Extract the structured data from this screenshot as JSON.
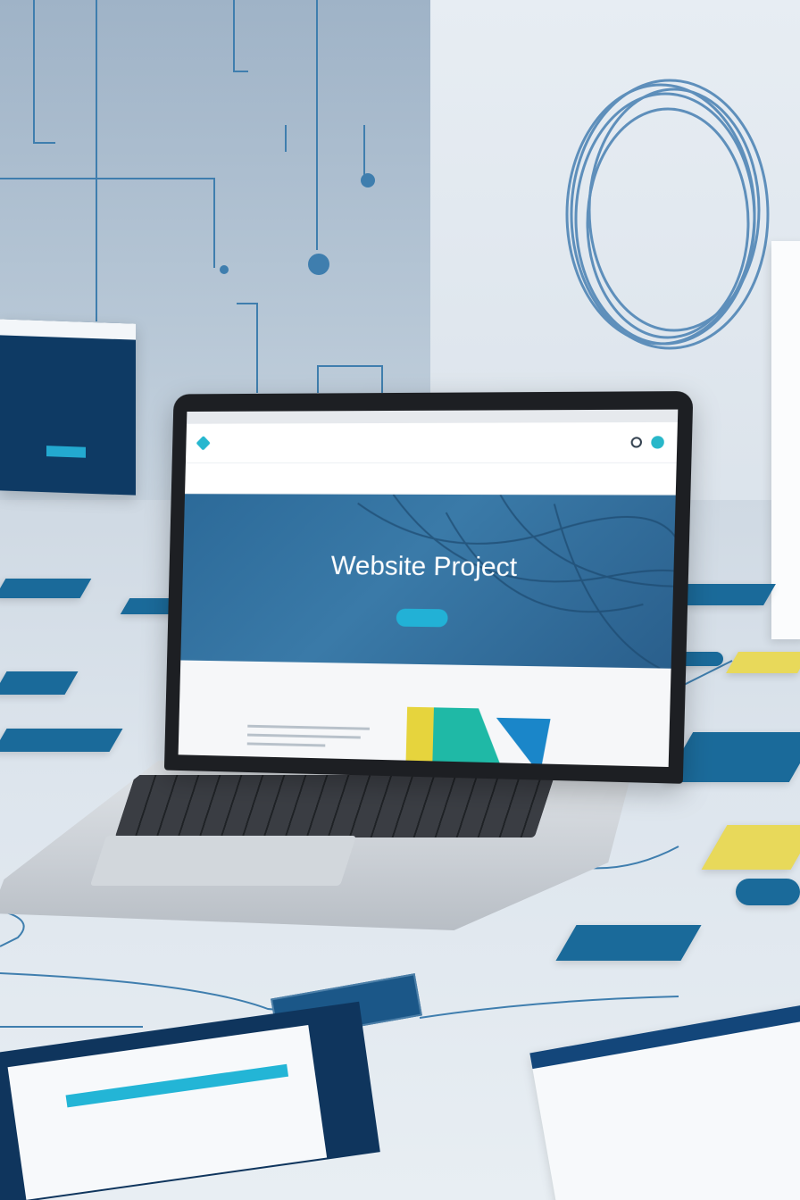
{
  "scene": {
    "colors": {
      "wall_left": "#a9bccf",
      "wall_right": "#e2e9ef",
      "floor": "#dbe3ea",
      "accent_blue": "#1a6a9a",
      "accent_cyan": "#22b1d6",
      "accent_yellow": "#e8d95a",
      "navy": "#0f355d"
    },
    "objects": [
      "laptop",
      "coiled-cable",
      "floating-website-panel",
      "code-printout",
      "circuit-board",
      "documents",
      "tiles"
    ]
  },
  "laptop_screen": {
    "hero_title": "Website Project",
    "icons": [
      "logo-icon",
      "search-icon",
      "avatar-icon"
    ]
  }
}
